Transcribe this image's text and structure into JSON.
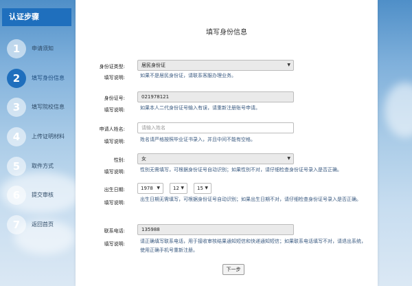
{
  "sidebar": {
    "title": "认证步骤",
    "steps": [
      {
        "number": "1",
        "label": "申请须知"
      },
      {
        "number": "2",
        "label": "填写身份信息"
      },
      {
        "number": "3",
        "label": "填写院校信息"
      },
      {
        "number": "4",
        "label": "上传证明材料"
      },
      {
        "number": "5",
        "label": "取件方式"
      },
      {
        "number": "6",
        "label": "提交审核"
      },
      {
        "number": "7",
        "label": "返回首页"
      }
    ],
    "active_step": 2
  },
  "form": {
    "title": "填写身份信息",
    "hint_label": "填写说明:",
    "id_type": {
      "label": "身份证类型:",
      "value": "居民身份证",
      "hint": "如果不是居民身份证，请联系客服办理业务。"
    },
    "id_number": {
      "label": "身份证号:",
      "value": "021978121",
      "hint": "如果本人二代身份证号输入有误，请重新注册账号申请。"
    },
    "name": {
      "label": "申请人姓名:",
      "placeholder": "请输入姓名",
      "hint": "姓名请严格按照毕业证书录入，并且中间不能有空格。"
    },
    "gender": {
      "label": "性别:",
      "value": "女",
      "hint": "性别无需填写，可根据身份证号自动识别；如果性别不对，请仔细检查身份证号录入是否正确。"
    },
    "birth": {
      "label": "出生日期:",
      "year": "1978",
      "month": "12",
      "day": "15",
      "hint": "出生日期无需填写，可根据身份证号自动识别；如果出生日期不对，请仔细检查身份证号录入是否正确。"
    },
    "phone": {
      "label": "联系电话:",
      "value": "135988",
      "hint": "请正确填写联系电话，用于接收审核结果通知短信和快递通知短信；如果联系电话填写不对，请退出系统，使用正确手机号重新注册。"
    },
    "next_label": "下一步"
  }
}
